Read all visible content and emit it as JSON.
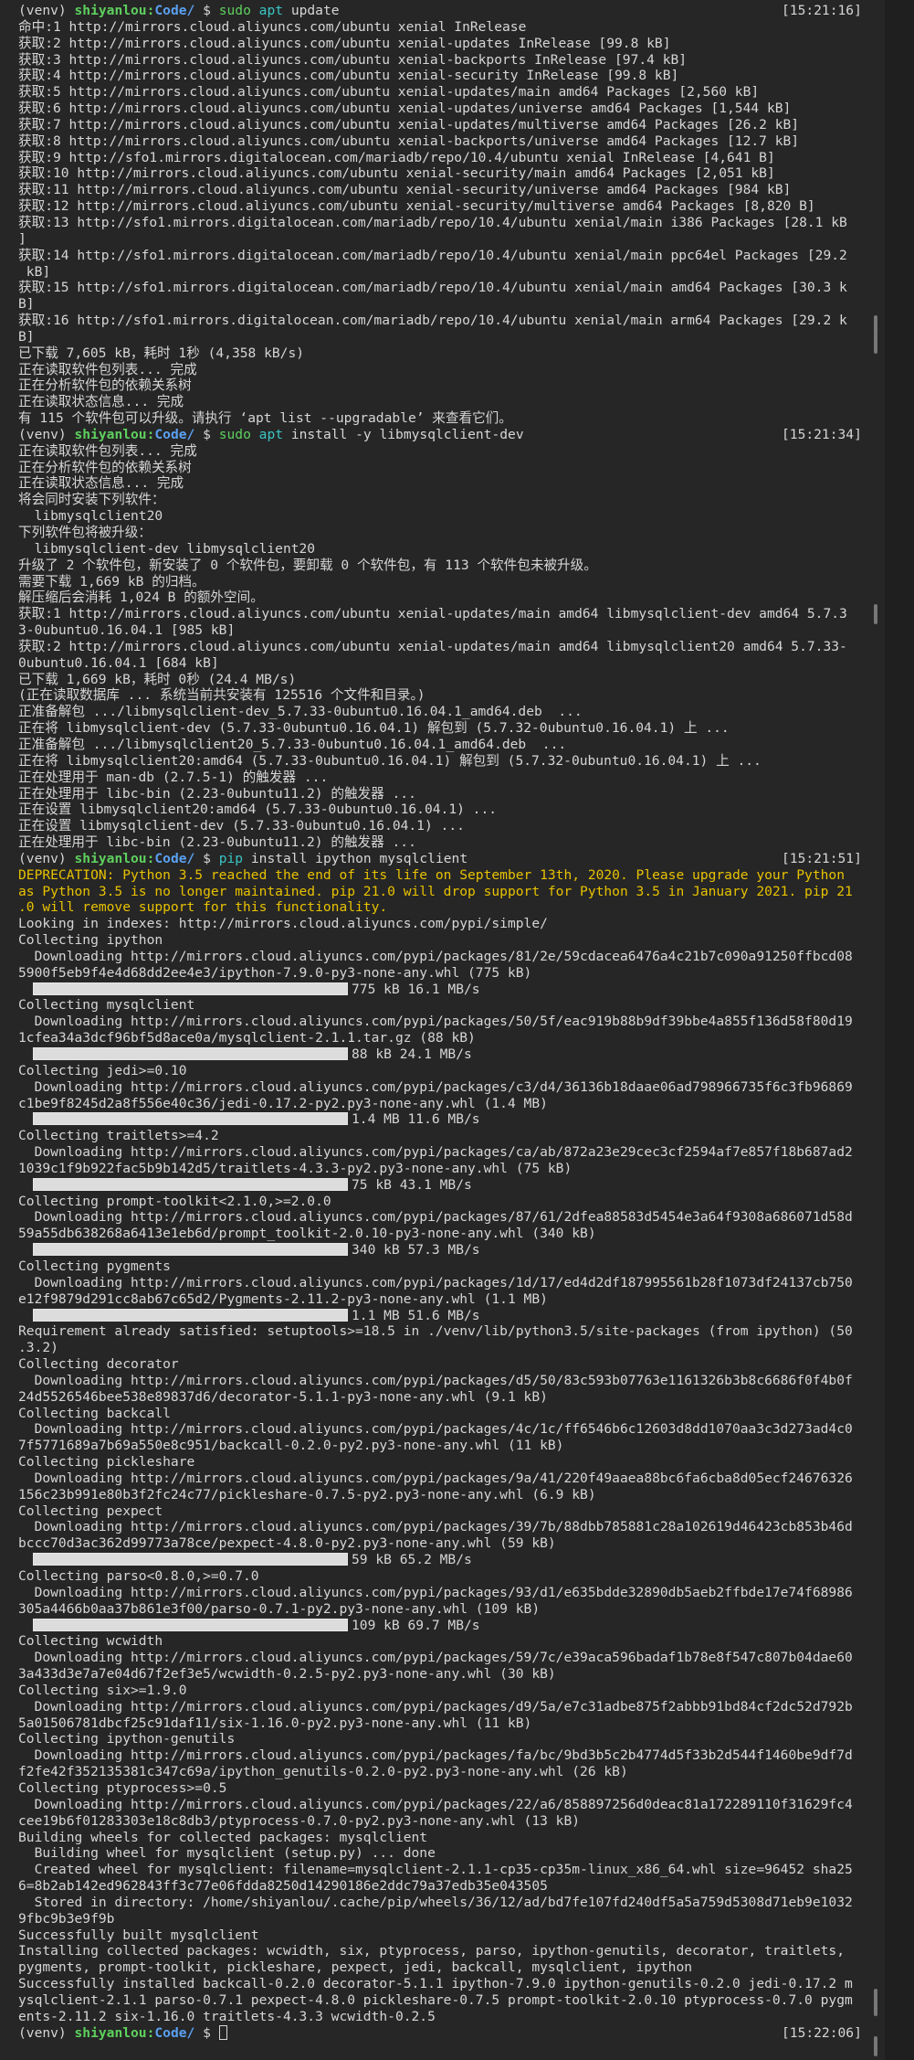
{
  "terminal": {
    "lines": [
      {
        "kind": "prompt",
        "venv": "(venv)",
        "user": "shiyanlou",
        "path": "Code/",
        "sym": "$",
        "prog": "sudo",
        "prog_class": "cmd-sudo",
        "subprog": "apt",
        "args": "update",
        "time": "[15:21:16]"
      },
      {
        "kind": "text",
        "text": "命中:1 http://mirrors.cloud.aliyuncs.com/ubuntu xenial InRelease"
      },
      {
        "kind": "text",
        "text": "获取:2 http://mirrors.cloud.aliyuncs.com/ubuntu xenial-updates InRelease [99.8 kB]"
      },
      {
        "kind": "text",
        "text": "获取:3 http://mirrors.cloud.aliyuncs.com/ubuntu xenial-backports InRelease [97.4 kB]"
      },
      {
        "kind": "text",
        "text": "获取:4 http://mirrors.cloud.aliyuncs.com/ubuntu xenial-security InRelease [99.8 kB]"
      },
      {
        "kind": "text",
        "text": "获取:5 http://mirrors.cloud.aliyuncs.com/ubuntu xenial-updates/main amd64 Packages [2,560 kB]"
      },
      {
        "kind": "text",
        "text": "获取:6 http://mirrors.cloud.aliyuncs.com/ubuntu xenial-updates/universe amd64 Packages [1,544 kB]"
      },
      {
        "kind": "text",
        "text": "获取:7 http://mirrors.cloud.aliyuncs.com/ubuntu xenial-updates/multiverse amd64 Packages [26.2 kB]"
      },
      {
        "kind": "text",
        "text": "获取:8 http://mirrors.cloud.aliyuncs.com/ubuntu xenial-backports/universe amd64 Packages [12.7 kB]"
      },
      {
        "kind": "text",
        "text": "获取:9 http://sfo1.mirrors.digitalocean.com/mariadb/repo/10.4/ubuntu xenial InRelease [4,641 B]"
      },
      {
        "kind": "text",
        "text": "获取:10 http://mirrors.cloud.aliyuncs.com/ubuntu xenial-security/main amd64 Packages [2,051 kB]"
      },
      {
        "kind": "text",
        "text": "获取:11 http://mirrors.cloud.aliyuncs.com/ubuntu xenial-security/universe amd64 Packages [984 kB]"
      },
      {
        "kind": "text",
        "text": "获取:12 http://mirrors.cloud.aliyuncs.com/ubuntu xenial-security/multiverse amd64 Packages [8,820 B]"
      },
      {
        "kind": "text",
        "text": "获取:13 http://sfo1.mirrors.digitalocean.com/mariadb/repo/10.4/ubuntu xenial/main i386 Packages [28.1 kB"
      },
      {
        "kind": "text",
        "text": "]"
      },
      {
        "kind": "text",
        "text": "获取:14 http://sfo1.mirrors.digitalocean.com/mariadb/repo/10.4/ubuntu xenial/main ppc64el Packages [29.2"
      },
      {
        "kind": "text",
        "text": " kB]"
      },
      {
        "kind": "text",
        "text": "获取:15 http://sfo1.mirrors.digitalocean.com/mariadb/repo/10.4/ubuntu xenial/main amd64 Packages [30.3 k"
      },
      {
        "kind": "text",
        "text": "B]"
      },
      {
        "kind": "text",
        "text": "获取:16 http://sfo1.mirrors.digitalocean.com/mariadb/repo/10.4/ubuntu xenial/main arm64 Packages [29.2 k"
      },
      {
        "kind": "text",
        "text": "B]"
      },
      {
        "kind": "text",
        "text": "已下载 7,605 kB，耗时 1秒 (4,358 kB/s)"
      },
      {
        "kind": "text",
        "text": "正在读取软件包列表... 完成"
      },
      {
        "kind": "text",
        "text": "正在分析软件包的依赖关系树"
      },
      {
        "kind": "text",
        "text": "正在读取状态信息... 完成"
      },
      {
        "kind": "text",
        "text": "有 115 个软件包可以升级。请执行 ‘apt list --upgradable’ 来查看它们。"
      },
      {
        "kind": "prompt",
        "venv": "(venv)",
        "user": "shiyanlou",
        "path": "Code/",
        "sym": "$",
        "prog": "sudo",
        "prog_class": "cmd-sudo",
        "subprog": "apt",
        "args": "install -y libmysqlclient-dev",
        "time": "[15:21:34]"
      },
      {
        "kind": "text",
        "text": "正在读取软件包列表... 完成"
      },
      {
        "kind": "text",
        "text": "正在分析软件包的依赖关系树"
      },
      {
        "kind": "text",
        "text": "正在读取状态信息... 完成"
      },
      {
        "kind": "text",
        "text": "将会同时安装下列软件："
      },
      {
        "kind": "text",
        "text": "  libmysqlclient20"
      },
      {
        "kind": "text",
        "text": "下列软件包将被升级："
      },
      {
        "kind": "text",
        "text": "  libmysqlclient-dev libmysqlclient20"
      },
      {
        "kind": "text",
        "text": "升级了 2 个软件包，新安装了 0 个软件包，要卸载 0 个软件包，有 113 个软件包未被升级。"
      },
      {
        "kind": "text",
        "text": "需要下载 1,669 kB 的归档。"
      },
      {
        "kind": "text",
        "text": "解压缩后会消耗 1,024 B 的额外空间。"
      },
      {
        "kind": "text",
        "text": "获取:1 http://mirrors.cloud.aliyuncs.com/ubuntu xenial-updates/main amd64 libmysqlclient-dev amd64 5.7.3"
      },
      {
        "kind": "text",
        "text": "3-0ubuntu0.16.04.1 [985 kB]"
      },
      {
        "kind": "text",
        "text": "获取:2 http://mirrors.cloud.aliyuncs.com/ubuntu xenial-updates/main amd64 libmysqlclient20 amd64 5.7.33-"
      },
      {
        "kind": "text",
        "text": "0ubuntu0.16.04.1 [684 kB]"
      },
      {
        "kind": "text",
        "text": "已下载 1,669 kB，耗时 0秒 (24.4 MB/s)"
      },
      {
        "kind": "text",
        "text": "(正在读取数据库 ... 系统当前共安装有 125516 个文件和目录。)"
      },
      {
        "kind": "text",
        "text": "正准备解包 .../libmysqlclient-dev_5.7.33-0ubuntu0.16.04.1_amd64.deb  ..."
      },
      {
        "kind": "text",
        "text": "正在将 libmysqlclient-dev (5.7.33-0ubuntu0.16.04.1) 解包到 (5.7.32-0ubuntu0.16.04.1) 上 ..."
      },
      {
        "kind": "text",
        "text": "正准备解包 .../libmysqlclient20_5.7.33-0ubuntu0.16.04.1_amd64.deb  ..."
      },
      {
        "kind": "text",
        "text": "正在将 libmysqlclient20:amd64 (5.7.33-0ubuntu0.16.04.1) 解包到 (5.7.32-0ubuntu0.16.04.1) 上 ..."
      },
      {
        "kind": "text",
        "text": "正在处理用于 man-db (2.7.5-1) 的触发器 ..."
      },
      {
        "kind": "text",
        "text": "正在处理用于 libc-bin (2.23-0ubuntu11.2) 的触发器 ..."
      },
      {
        "kind": "text",
        "text": "正在设置 libmysqlclient20:amd64 (5.7.33-0ubuntu0.16.04.1) ..."
      },
      {
        "kind": "text",
        "text": "正在设置 libmysqlclient-dev (5.7.33-0ubuntu0.16.04.1) ..."
      },
      {
        "kind": "text",
        "text": "正在处理用于 libc-bin (2.23-0ubuntu11.2) 的触发器 ..."
      },
      {
        "kind": "prompt",
        "venv": "(venv)",
        "user": "shiyanlou",
        "path": "Code/",
        "sym": "$",
        "prog": "pip",
        "prog_class": "cmd-prog",
        "subprog": "",
        "args": "install ipython mysqlclient",
        "time": "[15:21:51]"
      },
      {
        "kind": "warn",
        "text": "DEPRECATION: Python 3.5 reached the end of its life on September 13th, 2020. Please upgrade your Python"
      },
      {
        "kind": "warn",
        "text": "as Python 3.5 is no longer maintained. pip 21.0 will drop support for Python 3.5 in January 2021. pip 21"
      },
      {
        "kind": "warn",
        "text": ".0 will remove support for this functionality."
      },
      {
        "kind": "text",
        "text": "Looking in indexes: http://mirrors.cloud.aliyuncs.com/pypi/simple/"
      },
      {
        "kind": "text",
        "text": "Collecting ipython"
      },
      {
        "kind": "text",
        "text": "  Downloading http://mirrors.cloud.aliyuncs.com/pypi/packages/81/2e/59cdacea6476a4c21b7c090a91250ffbcd08"
      },
      {
        "kind": "text",
        "text": "5900f5eb9f4e4d68dd2ee4e3/ipython-7.9.0-py3-none-any.whl (775 kB)"
      },
      {
        "kind": "progress",
        "text": "775 kB 16.1 MB/s"
      },
      {
        "kind": "text",
        "text": "Collecting mysqlclient"
      },
      {
        "kind": "text",
        "text": "  Downloading http://mirrors.cloud.aliyuncs.com/pypi/packages/50/5f/eac919b88b9df39bbe4a855f136d58f80d19"
      },
      {
        "kind": "text",
        "text": "1cfea34a3dcf96bf5d8ace0a/mysqlclient-2.1.1.tar.gz (88 kB)"
      },
      {
        "kind": "progress",
        "text": "88 kB 24.1 MB/s"
      },
      {
        "kind": "text",
        "text": "Collecting jedi>=0.10"
      },
      {
        "kind": "text",
        "text": "  Downloading http://mirrors.cloud.aliyuncs.com/pypi/packages/c3/d4/36136b18daae06ad798966735f6c3fb96869"
      },
      {
        "kind": "text",
        "text": "c1be9f8245d2a8f556e40c36/jedi-0.17.2-py2.py3-none-any.whl (1.4 MB)"
      },
      {
        "kind": "progress",
        "text": "1.4 MB 11.6 MB/s"
      },
      {
        "kind": "text",
        "text": "Collecting traitlets>=4.2"
      },
      {
        "kind": "text",
        "text": "  Downloading http://mirrors.cloud.aliyuncs.com/pypi/packages/ca/ab/872a23e29cec3cf2594af7e857f18b687ad2"
      },
      {
        "kind": "text",
        "text": "1039c1f9b922fac5b9b142d5/traitlets-4.3.3-py2.py3-none-any.whl (75 kB)"
      },
      {
        "kind": "progress",
        "text": "75 kB 43.1 MB/s"
      },
      {
        "kind": "text",
        "text": "Collecting prompt-toolkit<2.1.0,>=2.0.0"
      },
      {
        "kind": "text",
        "text": "  Downloading http://mirrors.cloud.aliyuncs.com/pypi/packages/87/61/2dfea88583d5454e3a64f9308a686071d58d"
      },
      {
        "kind": "text",
        "text": "59a55db638268a6413e1eb6d/prompt_toolkit-2.0.10-py3-none-any.whl (340 kB)"
      },
      {
        "kind": "progress",
        "text": "340 kB 57.3 MB/s"
      },
      {
        "kind": "text",
        "text": "Collecting pygments"
      },
      {
        "kind": "text",
        "text": "  Downloading http://mirrors.cloud.aliyuncs.com/pypi/packages/1d/17/ed4d2df187995561b28f1073df24137cb750"
      },
      {
        "kind": "text",
        "text": "e12f9879d291cc8ab67c65d2/Pygments-2.11.2-py3-none-any.whl (1.1 MB)"
      },
      {
        "kind": "progress",
        "text": "1.1 MB 51.6 MB/s"
      },
      {
        "kind": "text",
        "text": "Requirement already satisfied: setuptools>=18.5 in ./venv/lib/python3.5/site-packages (from ipython) (50"
      },
      {
        "kind": "text",
        "text": ".3.2)"
      },
      {
        "kind": "text",
        "text": "Collecting decorator"
      },
      {
        "kind": "text",
        "text": "  Downloading http://mirrors.cloud.aliyuncs.com/pypi/packages/d5/50/83c593b07763e1161326b3b8c6686f0f4b0f"
      },
      {
        "kind": "text",
        "text": "24d5526546bee538e89837d6/decorator-5.1.1-py3-none-any.whl (9.1 kB)"
      },
      {
        "kind": "text",
        "text": "Collecting backcall"
      },
      {
        "kind": "text",
        "text": "  Downloading http://mirrors.cloud.aliyuncs.com/pypi/packages/4c/1c/ff6546b6c12603d8dd1070aa3c3d273ad4c0"
      },
      {
        "kind": "text",
        "text": "7f5771689a7b69a550e8c951/backcall-0.2.0-py2.py3-none-any.whl (11 kB)"
      },
      {
        "kind": "text",
        "text": "Collecting pickleshare"
      },
      {
        "kind": "text",
        "text": "  Downloading http://mirrors.cloud.aliyuncs.com/pypi/packages/9a/41/220f49aaea88bc6fa6cba8d05ecf24676326"
      },
      {
        "kind": "text",
        "text": "156c23b991e80b3f2fc24c77/pickleshare-0.7.5-py2.py3-none-any.whl (6.9 kB)"
      },
      {
        "kind": "text",
        "text": "Collecting pexpect"
      },
      {
        "kind": "text",
        "text": "  Downloading http://mirrors.cloud.aliyuncs.com/pypi/packages/39/7b/88dbb785881c28a102619d46423cb853b46d"
      },
      {
        "kind": "text",
        "text": "bccc70d3ac362d99773a78ce/pexpect-4.8.0-py2.py3-none-any.whl (59 kB)"
      },
      {
        "kind": "progress",
        "text": "59 kB 65.2 MB/s"
      },
      {
        "kind": "text",
        "text": "Collecting parso<0.8.0,>=0.7.0"
      },
      {
        "kind": "text",
        "text": "  Downloading http://mirrors.cloud.aliyuncs.com/pypi/packages/93/d1/e635bdde32890db5aeb2ffbde17e74f68986"
      },
      {
        "kind": "text",
        "text": "305a4466b0aa37b861e3f00/parso-0.7.1-py2.py3-none-any.whl (109 kB)"
      },
      {
        "kind": "progress",
        "text": "109 kB 69.7 MB/s"
      },
      {
        "kind": "text",
        "text": "Collecting wcwidth"
      },
      {
        "kind": "text",
        "text": "  Downloading http://mirrors.cloud.aliyuncs.com/pypi/packages/59/7c/e39aca596badaf1b78e8f547c807b04dae60"
      },
      {
        "kind": "text",
        "text": "3a433d3e7a7e04d67f2ef3e5/wcwidth-0.2.5-py2.py3-none-any.whl (30 kB)"
      },
      {
        "kind": "text",
        "text": "Collecting six>=1.9.0"
      },
      {
        "kind": "text",
        "text": "  Downloading http://mirrors.cloud.aliyuncs.com/pypi/packages/d9/5a/e7c31adbe875f2abbb91bd84cf2dc52d792b"
      },
      {
        "kind": "text",
        "text": "5a01506781dbcf25c91daf11/six-1.16.0-py2.py3-none-any.whl (11 kB)"
      },
      {
        "kind": "text",
        "text": "Collecting ipython-genutils"
      },
      {
        "kind": "text",
        "text": "  Downloading http://mirrors.cloud.aliyuncs.com/pypi/packages/fa/bc/9bd3b5c2b4774d5f33b2d544f1460be9df7d"
      },
      {
        "kind": "text",
        "text": "f2fe42f352135381c347c69a/ipython_genutils-0.2.0-py2.py3-none-any.whl (26 kB)"
      },
      {
        "kind": "text",
        "text": "Collecting ptyprocess>=0.5"
      },
      {
        "kind": "text",
        "text": "  Downloading http://mirrors.cloud.aliyuncs.com/pypi/packages/22/a6/858897256d0deac81a172289110f31629fc4"
      },
      {
        "kind": "text",
        "text": "cee19b6f01283303e18c8db3/ptyprocess-0.7.0-py2.py3-none-any.whl (13 kB)"
      },
      {
        "kind": "text",
        "text": "Building wheels for collected packages: mysqlclient"
      },
      {
        "kind": "text",
        "text": "  Building wheel for mysqlclient (setup.py) ... done"
      },
      {
        "kind": "text",
        "text": "  Created wheel for mysqlclient: filename=mysqlclient-2.1.1-cp35-cp35m-linux_x86_64.whl size=96452 sha25"
      },
      {
        "kind": "text",
        "text": "6=8b2ab142ed962843ff3c77e06fdda8250d14290186e2ddc79a37edb35e043505"
      },
      {
        "kind": "text",
        "text": "  Stored in directory: /home/shiyanlou/.cache/pip/wheels/36/12/ad/bd7fe107fd240df5a5a759d5308d71eb9e1032"
      },
      {
        "kind": "text",
        "text": "9fbc9b3e9f9b"
      },
      {
        "kind": "text",
        "text": "Successfully built mysqlclient"
      },
      {
        "kind": "text",
        "text": "Installing collected packages: wcwidth, six, ptyprocess, parso, ipython-genutils, decorator, traitlets,"
      },
      {
        "kind": "text",
        "text": "pygments, prompt-toolkit, pickleshare, pexpect, jedi, backcall, mysqlclient, ipython"
      },
      {
        "kind": "text",
        "text": "Successfully installed backcall-0.2.0 decorator-5.1.1 ipython-7.9.0 ipython-genutils-0.2.0 jedi-0.17.2 m"
      },
      {
        "kind": "text",
        "text": "ysqlclient-2.1.1 parso-0.7.1 pexpect-4.8.0 pickleshare-0.7.5 prompt-toolkit-2.0.10 ptyprocess-0.7.0 pygm"
      },
      {
        "kind": "text",
        "text": "ents-2.11.2 six-1.16.0 traitlets-4.3.3 wcwidth-0.2.5"
      },
      {
        "kind": "prompt",
        "venv": "(venv)",
        "user": "shiyanlou",
        "path": "Code/",
        "sym": "$",
        "prog": "",
        "prog_class": "",
        "subprog": "",
        "args": "",
        "time": "[15:22:06]",
        "cursor": true
      }
    ]
  },
  "colors": {
    "background": "#262626",
    "text": "#d6d6d6",
    "user": "#5ed05e",
    "path": "#5aa0f0",
    "warning": "#e8c200",
    "command": "#3ac4c4"
  }
}
